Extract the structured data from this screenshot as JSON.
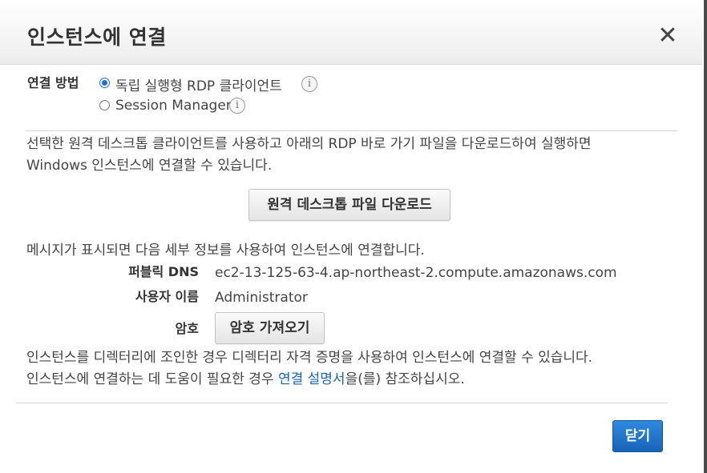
{
  "dialog": {
    "title": "인스턴스에 연결",
    "close_symbol": "✕"
  },
  "connection_method": {
    "label": "연결 방법",
    "options": [
      {
        "label": "독립 실행형 RDP 클라이언트",
        "selected": true
      },
      {
        "label": "Session Manager",
        "selected": false
      }
    ],
    "info_symbol": "i"
  },
  "description": {
    "line1": "선택한 원격 데스크톱 클라이언트를 사용하고 아래의 RDP 바로 가기 파일을 다운로드하여 실행하면",
    "line2": "Windows 인스턴스에 연결할 수 있습니다."
  },
  "download_button": "원격 데스크톱 파일 다운로드",
  "details_intro": "메시지가 표시되면 다음 세부 정보를 사용하여 인스턴스에 연결합니다.",
  "details": {
    "dns_label": "퍼블릭 DNS",
    "dns_value": "ec2-13-125-63-4.ap-northeast-2.compute.amazonaws.com",
    "user_label": "사용자 이름",
    "user_value": "Administrator",
    "password_label": "암호",
    "password_button": "암호 가져오기"
  },
  "footer_text": {
    "line1": "인스턴스를 디렉터리에 조인한 경우 디렉터리 자격 증명을 사용하여 인스턴스에 연결할 수 있습니다.",
    "line2_pre": "인스턴스에 연결하는 데 도움이 필요한 경우 ",
    "line2_link": "연결 설명서",
    "line2_post": "을(를) 참조하십시오."
  },
  "close_button": "닫기",
  "colors": {
    "primary": "#1a6fd0",
    "link": "#1a63b0"
  }
}
